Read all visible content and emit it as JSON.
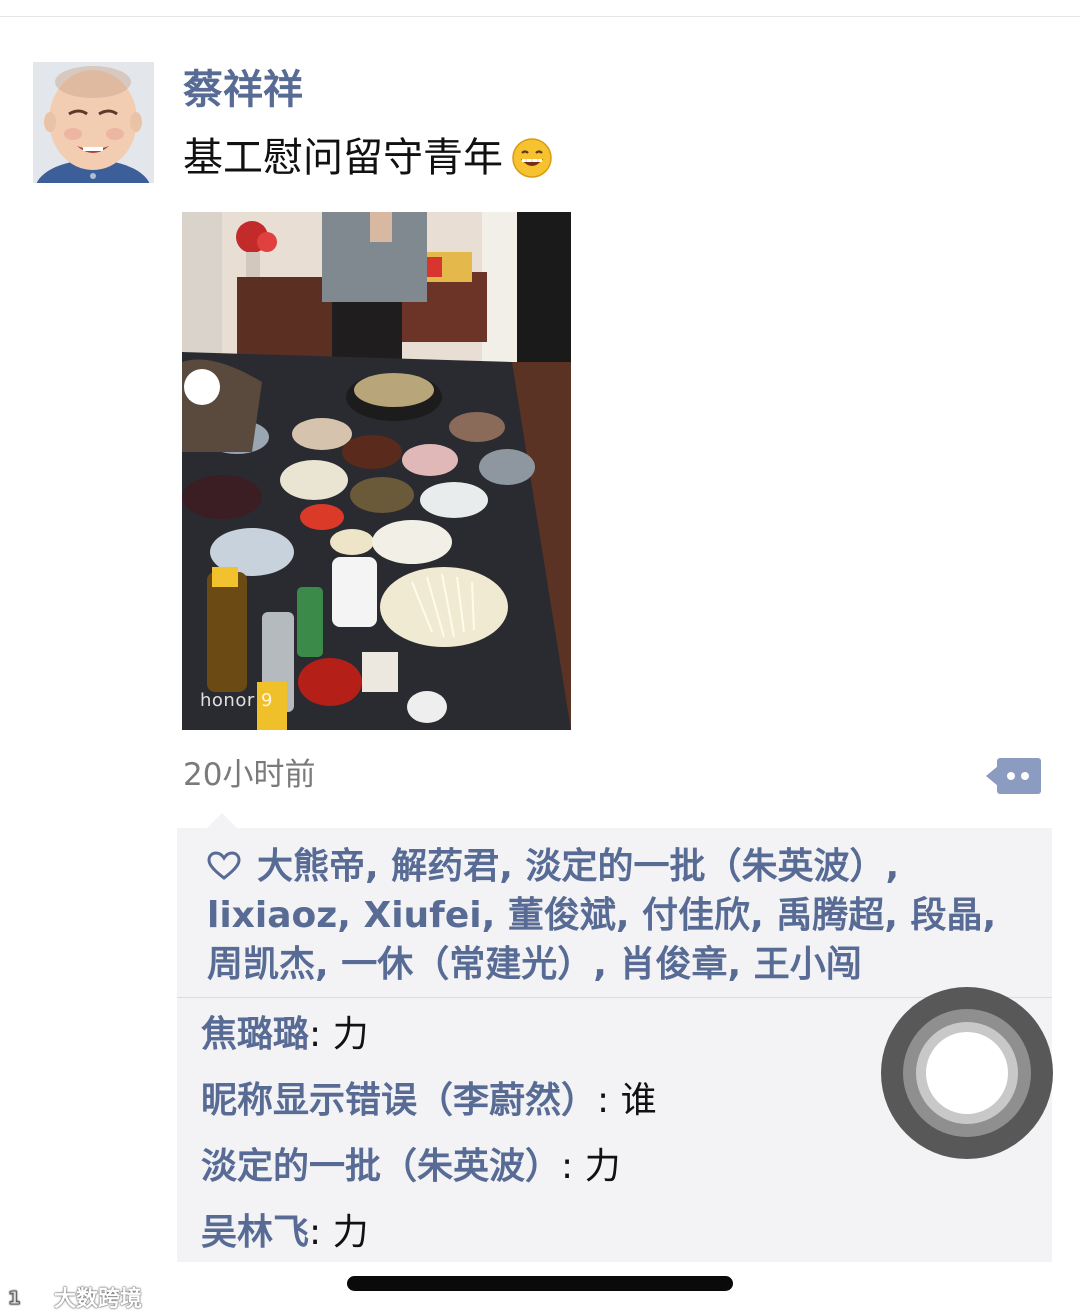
{
  "post": {
    "username": "蔡祥祥",
    "text": "基工慰问留守青年",
    "emoji_icon": "grinning-face-emoji",
    "photo_watermark": "honor 9",
    "timestamp": "20小时前",
    "comment_button_icon": "comment-bubble-icon"
  },
  "likes": {
    "icon": "heart-outline-icon",
    "names": [
      "大熊帝",
      "解药君",
      "淡定的一批（朱英波）",
      "lixiaoz",
      "Xiufei",
      "董俊斌",
      "付佳欣",
      "禹腾超",
      "段晶",
      "周凯杰",
      "一休（常建光）",
      "肖俊章",
      "王小闯"
    ],
    "separator": ", "
  },
  "comments": [
    {
      "name": "焦璐璐",
      "text": "力"
    },
    {
      "name": "昵称显示错误（李蔚然）",
      "text": "谁"
    },
    {
      "name": "淡定的一批（朱英波）",
      "text": "力"
    },
    {
      "name": "吴林飞",
      "text": "力"
    }
  ],
  "watermark": {
    "text": "大数跨境",
    "logo_icon": "source-logo-icon"
  },
  "colors": {
    "link": "#576b95",
    "panel": "#f3f3f5",
    "timestamp": "#7a7a7a"
  }
}
